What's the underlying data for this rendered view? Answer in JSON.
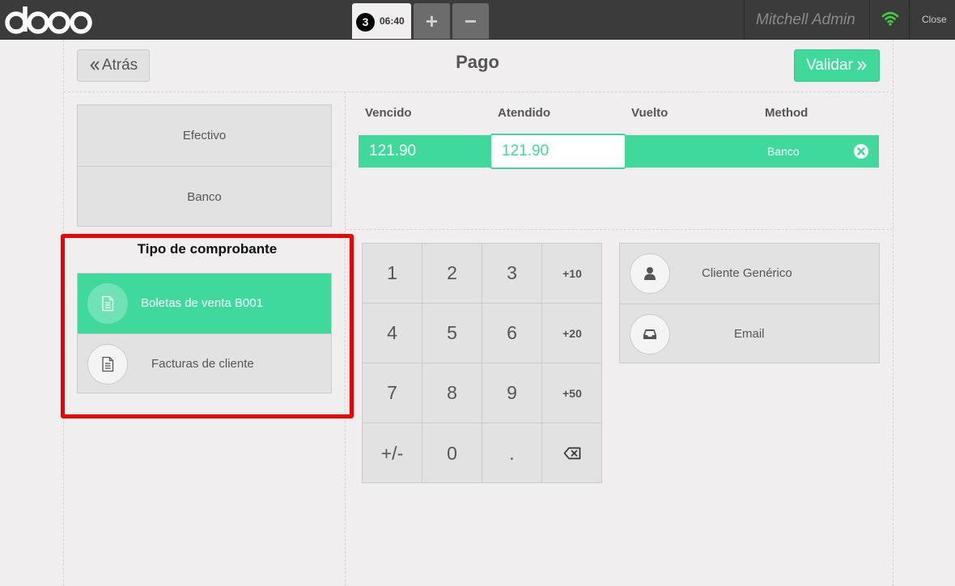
{
  "topbar": {
    "brand": "odoo",
    "order_number": "3",
    "order_time": "06:40",
    "add_order": "+",
    "remove_order": "−",
    "user": "Mitchell Admin",
    "close": "Close",
    "connection_color": "#3fcf3f"
  },
  "header": {
    "back": "Atrás",
    "title": "Pago",
    "validate": "Validar"
  },
  "payment_methods": [
    "Efectivo",
    "Banco"
  ],
  "paymentlines": {
    "columns": [
      "Vencido",
      "Atendido",
      "Vuelto",
      "Method"
    ],
    "rows": [
      {
        "due": "121.90",
        "tendered": "121.90",
        "change": "",
        "method": "Banco"
      }
    ]
  },
  "voucher": {
    "title": "Tipo de comprobante",
    "items": [
      {
        "label": "Boletas de venta B001",
        "selected": true,
        "icon": "document-icon"
      },
      {
        "label": "Facturas de cliente",
        "selected": false,
        "icon": "document-icon"
      }
    ]
  },
  "numpad": {
    "keys": [
      "1",
      "2",
      "3",
      "+10",
      "4",
      "5",
      "6",
      "+20",
      "7",
      "8",
      "9",
      "+50",
      "+/-",
      "0",
      ".",
      ""
    ]
  },
  "extras": {
    "customer": "Cliente Genérico",
    "email": "Email"
  },
  "colors": {
    "accent": "#40d99c",
    "topbar": "#3b3b3b",
    "background": "#f0eeee",
    "highlight": "#ee0000"
  }
}
